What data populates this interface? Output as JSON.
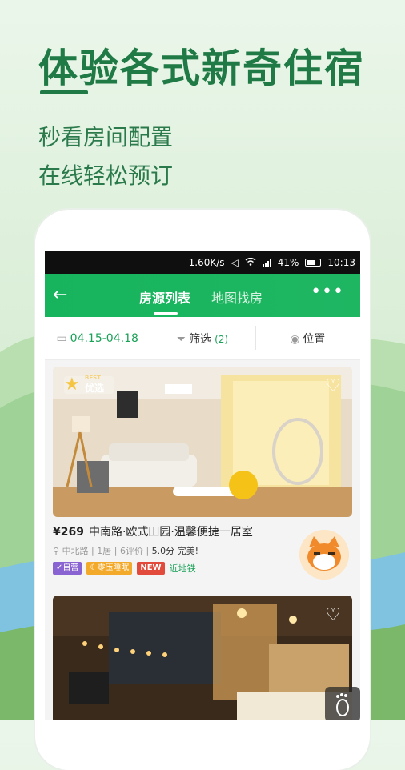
{
  "promo": {
    "headline": "体验各式新奇住宿",
    "line1": "秒看房间配置",
    "line2": "在线轻松预订"
  },
  "statusbar": {
    "speed": "1.60K/s",
    "battery": "41%",
    "time": "10:13"
  },
  "navbar": {
    "back_icon": "←",
    "tab_list": "房源列表",
    "tab_map": "地图找房",
    "more_icon": "•••"
  },
  "filters": {
    "dates": "04.15-04.18",
    "filter_label": "筛选",
    "filter_count": "(2)",
    "location_label": "位置"
  },
  "listing1": {
    "badge_word": "BEST",
    "badge_label": "优选",
    "price": "¥269",
    "title": "中南路·欧式田园·温馨便捷一居室",
    "meta_location": "中北路",
    "meta_rooms": "1居",
    "meta_reviews": "6评价",
    "meta_score": "5.0分",
    "meta_comment": "完美!",
    "tags": {
      "self_run": "自营",
      "sleep": "零压睡眠",
      "new": "NEW",
      "metro": "近地铁"
    }
  },
  "colors": {
    "brand": "#1fb662",
    "headline": "#1f7a45"
  }
}
